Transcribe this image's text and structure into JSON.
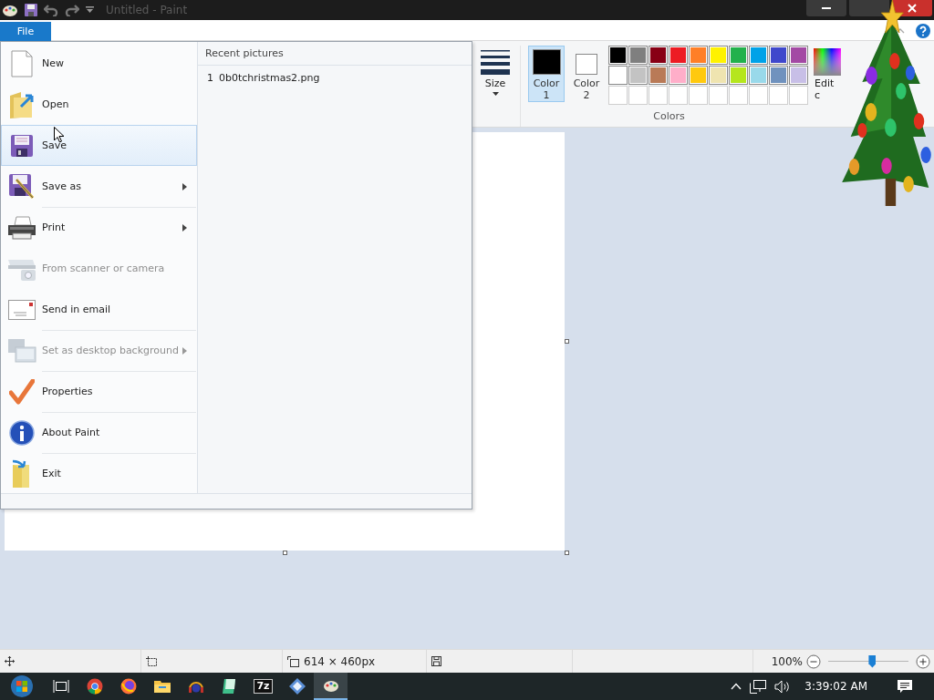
{
  "window": {
    "title": "Untitled - Paint"
  },
  "file_tab": {
    "label": "File",
    "selected": true
  },
  "file_menu": {
    "items": [
      {
        "kind": "new",
        "label": "New",
        "selected": false,
        "disabled": false,
        "submenu": false,
        "separator": false
      },
      {
        "kind": "open",
        "label": "Open",
        "selected": false,
        "disabled": false,
        "submenu": false,
        "separator": false
      },
      {
        "kind": "save",
        "label": "Save",
        "selected": true,
        "disabled": false,
        "submenu": false,
        "separator": false
      },
      {
        "kind": "saveas",
        "label": "Save as",
        "selected": false,
        "disabled": false,
        "submenu": true,
        "separator": false
      },
      {
        "kind": "print",
        "label": "Print",
        "selected": false,
        "disabled": false,
        "submenu": true,
        "separator": true
      },
      {
        "kind": "scanner",
        "label": "From scanner or camera",
        "selected": false,
        "disabled": true,
        "submenu": false,
        "separator": false
      },
      {
        "kind": "email",
        "label": "Send in email",
        "selected": false,
        "disabled": false,
        "submenu": false,
        "separator": false
      },
      {
        "kind": "desktop",
        "label": "Set as desktop background",
        "selected": false,
        "disabled": true,
        "submenu": true,
        "separator": true
      },
      {
        "kind": "properties",
        "label": "Properties",
        "selected": false,
        "disabled": false,
        "submenu": false,
        "separator": true
      },
      {
        "kind": "about",
        "label": "About Paint",
        "selected": false,
        "disabled": false,
        "submenu": false,
        "separator": true
      },
      {
        "kind": "exit",
        "label": "Exit",
        "selected": false,
        "disabled": false,
        "submenu": false,
        "separator": true
      }
    ],
    "recent": {
      "heading": "Recent pictures",
      "items": [
        {
          "index": "1",
          "name": "0b0tchristmas2.png"
        }
      ]
    }
  },
  "ribbon": {
    "size": {
      "label": "Size"
    },
    "colors": {
      "label": "Colors",
      "primary": {
        "label": "Color 1",
        "color": "#000000",
        "selected": true
      },
      "secondary": {
        "label": "Color 2",
        "color": "#ffffff",
        "selected": false
      },
      "palette": [
        {
          "swatches": [
            {
              "color": "#000000"
            },
            {
              "color": "#7f7f7f"
            },
            {
              "color": "#880015"
            },
            {
              "color": "#ed1c24"
            },
            {
              "color": "#ff7f27"
            },
            {
              "color": "#fff200"
            },
            {
              "color": "#22b14c"
            },
            {
              "color": "#00a2e8"
            },
            {
              "color": "#3f48cc"
            },
            {
              "color": "#a349a4"
            }
          ]
        },
        {
          "swatches": [
            {
              "color": "#ffffff"
            },
            {
              "color": "#c3c3c3"
            },
            {
              "color": "#b97a57"
            },
            {
              "color": "#ffaec9"
            },
            {
              "color": "#ffc90e"
            },
            {
              "color": "#efe4b0"
            },
            {
              "color": "#b5e61d"
            },
            {
              "color": "#99d9ea"
            },
            {
              "color": "#7092be"
            },
            {
              "color": "#c8bfe7"
            }
          ]
        },
        {
          "swatches": [
            {
              "kind": "empty"
            },
            {
              "kind": "empty"
            },
            {
              "kind": "empty"
            },
            {
              "kind": "empty"
            },
            {
              "kind": "empty"
            },
            {
              "kind": "empty"
            },
            {
              "kind": "empty"
            },
            {
              "kind": "empty"
            },
            {
              "kind": "empty"
            },
            {
              "kind": "empty"
            }
          ]
        }
      ],
      "edit": {
        "label": "Edit c"
      }
    }
  },
  "status_bar": {
    "dimensions": "614 × 460px",
    "zoom": "100%",
    "zoom_slider": {
      "level": 0.55
    }
  },
  "taskbar": {
    "apps": [
      {
        "kind": "start",
        "selected": false
      },
      {
        "kind": "taskview",
        "selected": false
      },
      {
        "kind": "chrome",
        "selected": false
      },
      {
        "kind": "firefox",
        "selected": false
      },
      {
        "kind": "explorer",
        "selected": false
      },
      {
        "kind": "media",
        "selected": false
      },
      {
        "kind": "notes",
        "selected": false
      },
      {
        "kind": "archiver",
        "label": "7z",
        "selected": false
      },
      {
        "kind": "diamond",
        "selected": false
      },
      {
        "kind": "paint",
        "selected": true
      }
    ],
    "clock": "3:39:02 AM"
  }
}
